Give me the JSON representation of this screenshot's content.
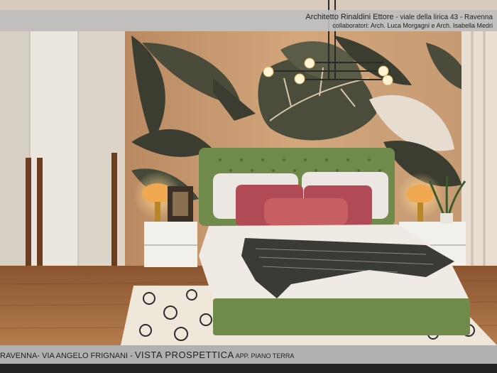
{
  "header": {
    "architect": "Architetto Rinaldini Ettore",
    "address": " - viale della lirica 43 - Ravenna",
    "collaborators": "collaboratori: Arch. Luca Morgagni e Arch. Isabella Medri"
  },
  "footer": {
    "location": "RAVENNA- VIA ANGELO FRIGNANI - ",
    "view_label": "VISTA PROSPETTICA",
    "unit_label": " APP. PIANO TERRA"
  },
  "colors": {
    "banner": "#bebebe",
    "bed_green": "#6f8a4a",
    "wallpaper_bg": "#c79a70",
    "leaf_dark": "#3a3d30",
    "pillow_red": "#b04a55",
    "floor_wood": "#a0683c",
    "wardrobe": "#e6e0d6"
  }
}
